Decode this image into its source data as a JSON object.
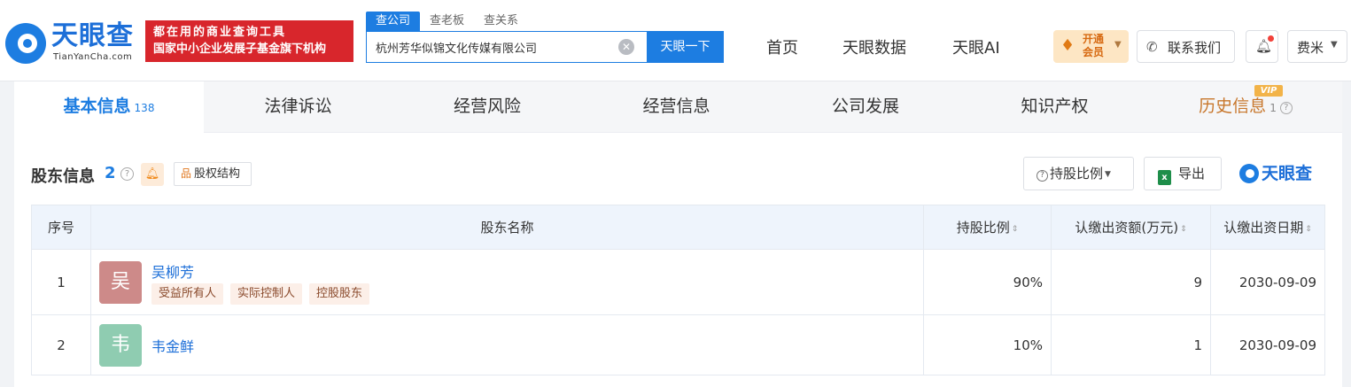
{
  "header": {
    "logo_text": "天眼查",
    "logo_sub": "TianYanCha.com",
    "slogan_line1": "都在用的商业查询工具",
    "slogan_line2": "国家中小企业发展子基金旗下机构",
    "search_tabs": [
      "查公司",
      "查老板",
      "查关系"
    ],
    "search_value": "杭州芳华似锦文化传媒有限公司",
    "search_button": "天眼一下",
    "nav": [
      "首页",
      "天眼数据",
      "天眼AI"
    ],
    "vip_line1": "开通",
    "vip_line2": "会员",
    "contact_label": "联系我们",
    "user_name": "费米"
  },
  "tabs": [
    {
      "label": "基本信息",
      "count": "138"
    },
    {
      "label": "法律诉讼"
    },
    {
      "label": "经营风险"
    },
    {
      "label": "经营信息"
    },
    {
      "label": "公司发展"
    },
    {
      "label": "知识产权"
    },
    {
      "label": "历史信息",
      "count": "1",
      "badge": "VIP"
    }
  ],
  "section": {
    "title": "股东信息",
    "count": "2",
    "equity_button": "股权结构",
    "ratio_button": "持股比例",
    "export_button": "导出",
    "brand": "天眼查"
  },
  "table": {
    "columns": [
      "序号",
      "股东名称",
      "持股比例",
      "认缴出资额(万元)",
      "认缴出资日期"
    ],
    "rows": [
      {
        "index": "1",
        "avatar": "吴",
        "avatar_color": "#cd8a89",
        "name": "吴柳芳",
        "tags": [
          "受益所有人",
          "实际控制人",
          "控股股东"
        ],
        "ratio": "90%",
        "amount": "9",
        "date": "2030-09-09"
      },
      {
        "index": "2",
        "avatar": "韦",
        "avatar_color": "#8fccb1",
        "name": "韦金鲜",
        "tags": [],
        "ratio": "10%",
        "amount": "1",
        "date": "2030-09-09"
      }
    ]
  }
}
